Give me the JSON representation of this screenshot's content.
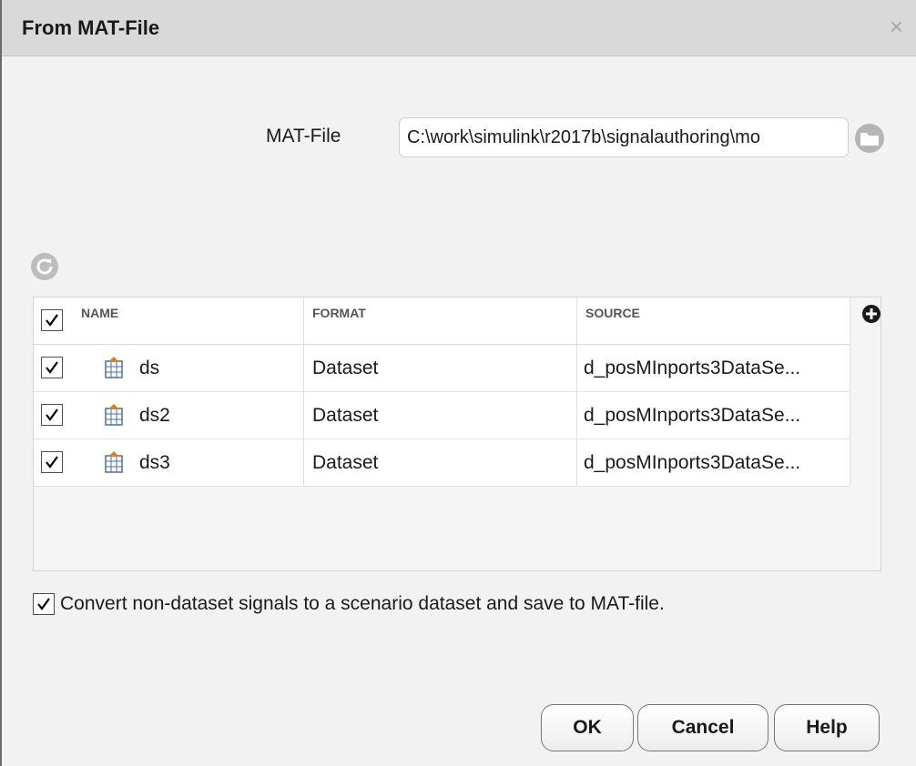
{
  "window": {
    "title": "From MAT-File",
    "close_glyph": "×"
  },
  "matfile": {
    "label": "MAT-File",
    "value": "C:\\work\\simulink\\r2017b\\signalauthoring\\mo",
    "browse_icon": "folder-icon"
  },
  "toolbar": {
    "refresh_icon": "refresh-icon",
    "add_icon": "add-icon"
  },
  "table": {
    "header_checked": true,
    "columns": [
      "NAME",
      "FORMAT",
      "SOURCE"
    ],
    "rows": [
      {
        "checked": true,
        "name": "ds",
        "format": "Dataset",
        "source": "d_posMInports3DataSe..."
      },
      {
        "checked": true,
        "name": "ds2",
        "format": "Dataset",
        "source": "d_posMInports3DataSe..."
      },
      {
        "checked": true,
        "name": "ds3",
        "format": "Dataset",
        "source": "d_posMInports3DataSe..."
      }
    ]
  },
  "convert": {
    "checked": true,
    "label": "Convert non-dataset signals to a scenario dataset and save to MAT-file."
  },
  "buttons": {
    "ok": "OK",
    "cancel": "Cancel",
    "help": "Help"
  },
  "colors": {
    "titlebar": "#d9d9d9",
    "dialog_bg": "#f2f2f2",
    "row_bg": "#ffffff",
    "border": "#767676"
  }
}
